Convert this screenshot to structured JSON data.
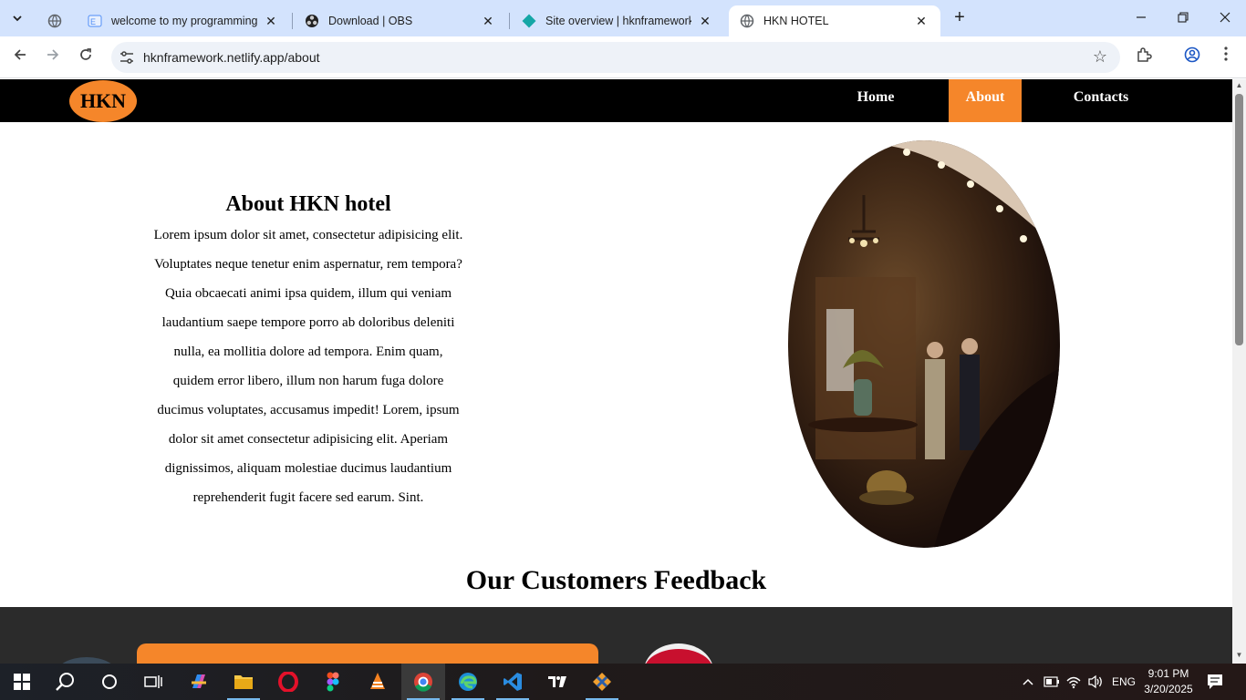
{
  "browser": {
    "tabs": [
      {
        "title": "welcome to my programming w",
        "active": false
      },
      {
        "title": "Download | OBS",
        "active": false
      },
      {
        "title": "Site overview | hknframework | N",
        "active": false
      },
      {
        "title": "HKN HOTEL",
        "active": true
      }
    ],
    "url": "hknframework.netlify.app/about"
  },
  "site": {
    "logo": "HKN",
    "nav": [
      {
        "label": "Home",
        "active": false
      },
      {
        "label": "About",
        "active": true
      },
      {
        "label": "Contacts",
        "active": false
      }
    ],
    "about": {
      "title": "About HKN hotel",
      "body": "Lorem ipsum dolor sit amet, consectetur adipisicing elit. Voluptates neque tenetur enim aspernatur, rem tempora? Quia obcaecati animi ipsa quidem, illum qui veniam laudantium saepe tempore porro ab doloribus deleniti nulla, ea mollitia dolore ad tempora. Enim quam, quidem error libero, illum non harum fuga dolore ducimus voluptates, accusamus impedit! Lorem, ipsum dolor sit amet consectetur adipisicing elit. Aperiam dignissimos, aliquam molestiae ducimus laudantium reprehenderit fugit facere sed earum. Sint."
    },
    "feedback_title": "Our Customers Feedback",
    "colors": {
      "accent": "#f5862a",
      "nav_bg": "#000000",
      "feedback_bg": "#2b2b2b"
    }
  },
  "taskbar": {
    "language": "ENG",
    "time": "9:01 PM",
    "date": "3/20/2025",
    "apps": [
      "start-icon",
      "search-icon",
      "cortana-icon",
      "task-view-icon",
      "copilot-icon",
      "file-explorer-icon",
      "opera-icon",
      "figma-icon",
      "vlc-icon",
      "chrome-icon",
      "edge-icon",
      "vscode-icon",
      "tradingview-icon",
      "git-icon"
    ]
  }
}
